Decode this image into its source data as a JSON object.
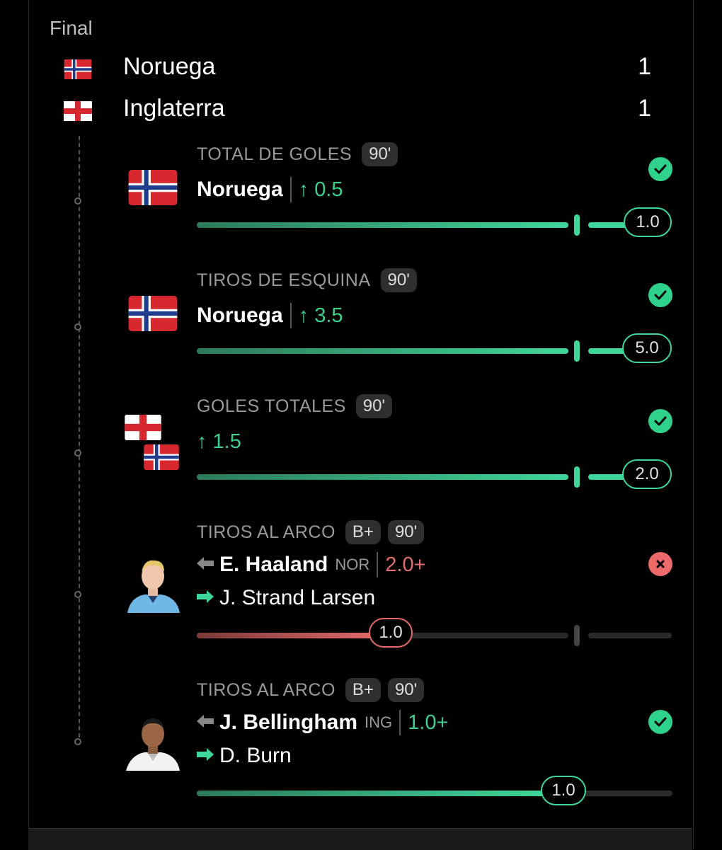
{
  "match": {
    "status": "Final",
    "home": {
      "name": "Noruega",
      "score": "1",
      "flag": "norway-flag"
    },
    "away": {
      "name": "Inglaterra",
      "score": "1",
      "flag": "england-flag"
    }
  },
  "picks": [
    {
      "market": "TOTAL DE GOLES",
      "period": "90'",
      "team": "Noruega",
      "line": "↑ 0.5",
      "result_value": "1.0",
      "outcome": "win",
      "progress": 1.0
    },
    {
      "market": "TIROS DE ESQUINA",
      "period": "90'",
      "team": "Noruega",
      "line": "↑ 3.5",
      "result_value": "5.0",
      "outcome": "win",
      "progress": 1.0
    },
    {
      "market": "GOLES TOTALES",
      "period": "90'",
      "line": "↑ 1.5",
      "result_value": "2.0",
      "outcome": "win",
      "progress": 1.0
    },
    {
      "market": "TIROS AL ARCO",
      "grade": "B+",
      "period": "90'",
      "player": "E. Haaland",
      "team_abbr": "NOR",
      "line": "2.0+",
      "sub_player": "J. Strand Larsen",
      "result_value": "1.0",
      "outcome": "lose",
      "progress": 0.5
    },
    {
      "market": "TIROS AL ARCO",
      "grade": "B+",
      "period": "90'",
      "player": "J. Bellingham",
      "team_abbr": "ING",
      "line": "1.0+",
      "sub_player": "D. Burn",
      "result_value": "1.0",
      "outcome": "win",
      "progress": 1.0
    }
  ],
  "colors": {
    "win": "#2fd28a",
    "lose": "#ec6a6a",
    "background": "#000000"
  }
}
